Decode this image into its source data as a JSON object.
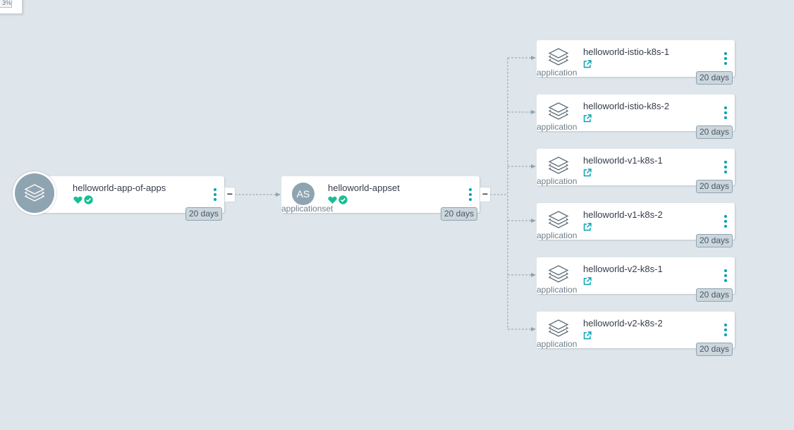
{
  "zoom": {
    "label": "3%"
  },
  "root": {
    "name": "helloworld-app-of-apps",
    "age": "20 days",
    "icon": "layers-icon",
    "collapse": "−",
    "health": "healthy",
    "sync": "synced"
  },
  "appset": {
    "name": "helloworld-appset",
    "kind": "applicationset",
    "badge": "AS",
    "age": "20 days",
    "collapse": "−",
    "health": "healthy",
    "sync": "synced"
  },
  "apps": [
    {
      "name": "helloworld-istio-k8s-1",
      "kind": "application",
      "age": "20 days"
    },
    {
      "name": "helloworld-istio-k8s-2",
      "kind": "application",
      "age": "20 days"
    },
    {
      "name": "helloworld-v1-k8s-1",
      "kind": "application",
      "age": "20 days"
    },
    {
      "name": "helloworld-v1-k8s-2",
      "kind": "application",
      "age": "20 days"
    },
    {
      "name": "helloworld-v2-k8s-1",
      "kind": "application",
      "age": "20 days"
    },
    {
      "name": "helloworld-v2-k8s-2",
      "kind": "application",
      "age": "20 days"
    }
  ],
  "colors": {
    "background": "#dee6eb",
    "health": "#18be94",
    "accent": "#00a2b3",
    "icon_gray": "#8fa4b1"
  }
}
